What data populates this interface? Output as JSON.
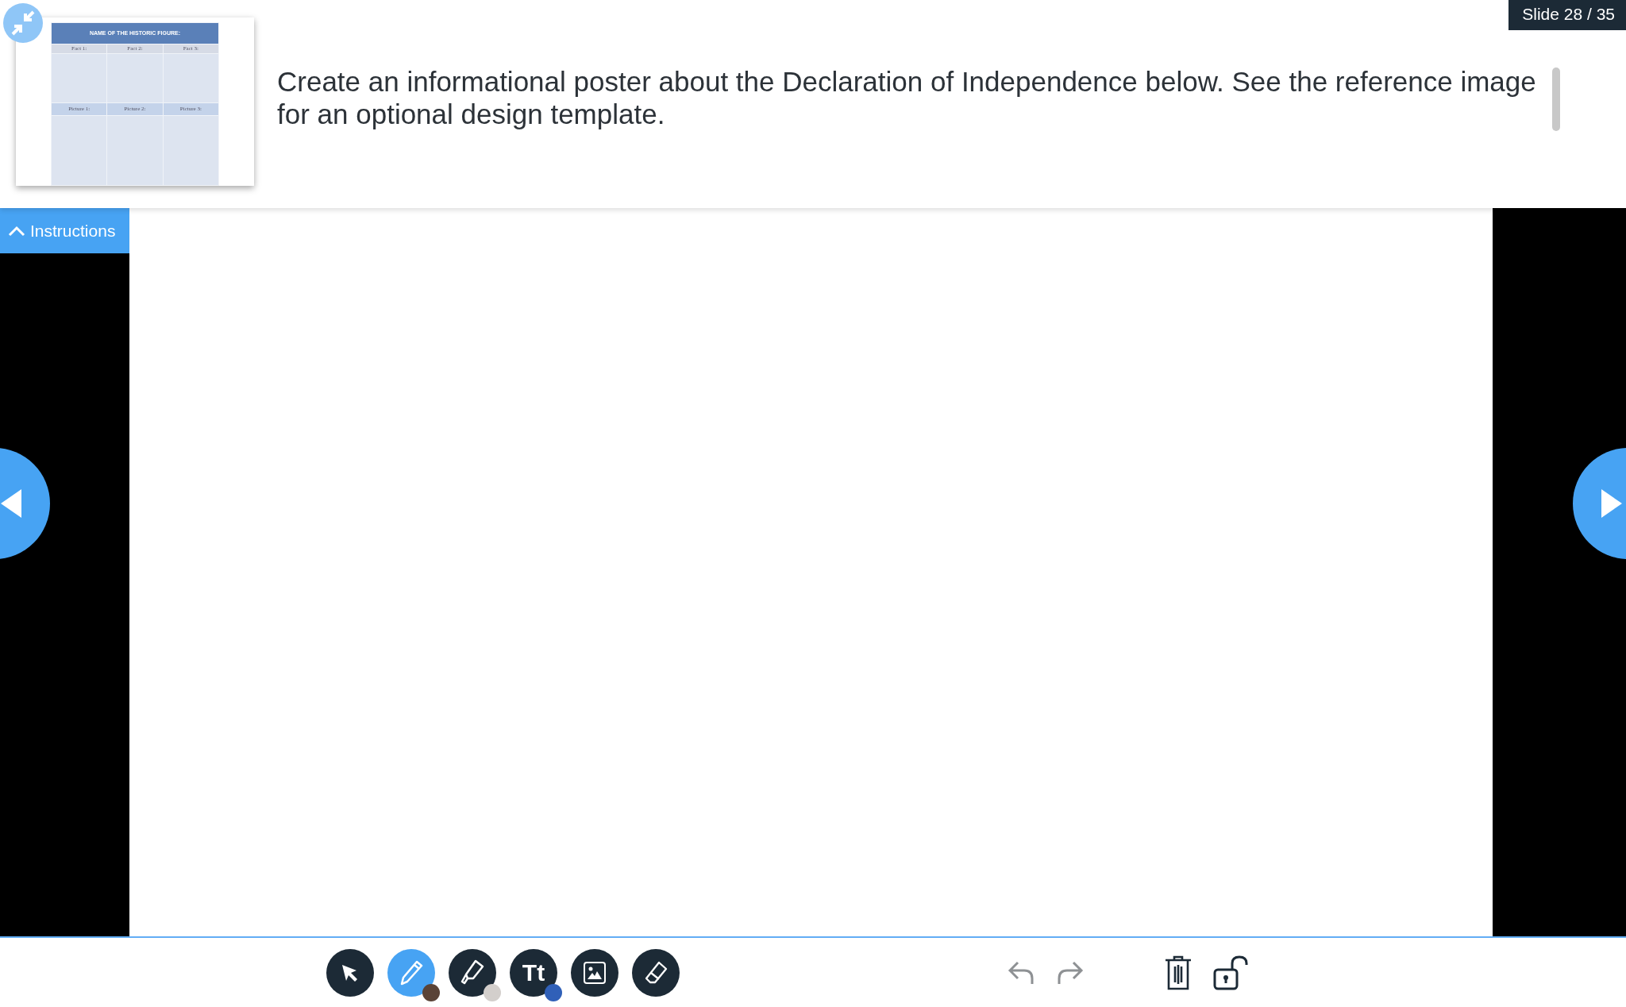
{
  "reference_image": {
    "title": "NAME OF THE HISTORIC FIGURE:",
    "rows": [
      {
        "kind": "fact",
        "labels": [
          "Fact 1:",
          "Fact 2:",
          "Fact 3:"
        ]
      },
      {
        "kind": "picture",
        "labels": [
          "Picture 1:",
          "Picture 2:",
          "Picture 3:"
        ]
      }
    ]
  },
  "instructions": "Create an informational poster about the Declaration of Independence below. See the reference image for an optional design template.",
  "slide_counter": "Slide 28 / 35",
  "instructions_tab": {
    "label": "Instructions",
    "expanded": true
  },
  "tools": [
    {
      "kind": "select",
      "selected": false
    },
    {
      "kind": "pen",
      "selected": true,
      "color": "#5a4337"
    },
    {
      "kind": "highlighter",
      "selected": false,
      "color": "#d3cfcc"
    },
    {
      "kind": "text",
      "label": "Tt",
      "selected": false,
      "color": "#3060b8"
    },
    {
      "kind": "image",
      "selected": false
    },
    {
      "kind": "eraser",
      "selected": false
    }
  ],
  "actions": [
    {
      "kind": "undo",
      "disabled": true
    },
    {
      "kind": "redo",
      "disabled": true
    },
    {
      "kind": "delete",
      "disabled": false
    },
    {
      "kind": "lock",
      "disabled": false
    }
  ]
}
